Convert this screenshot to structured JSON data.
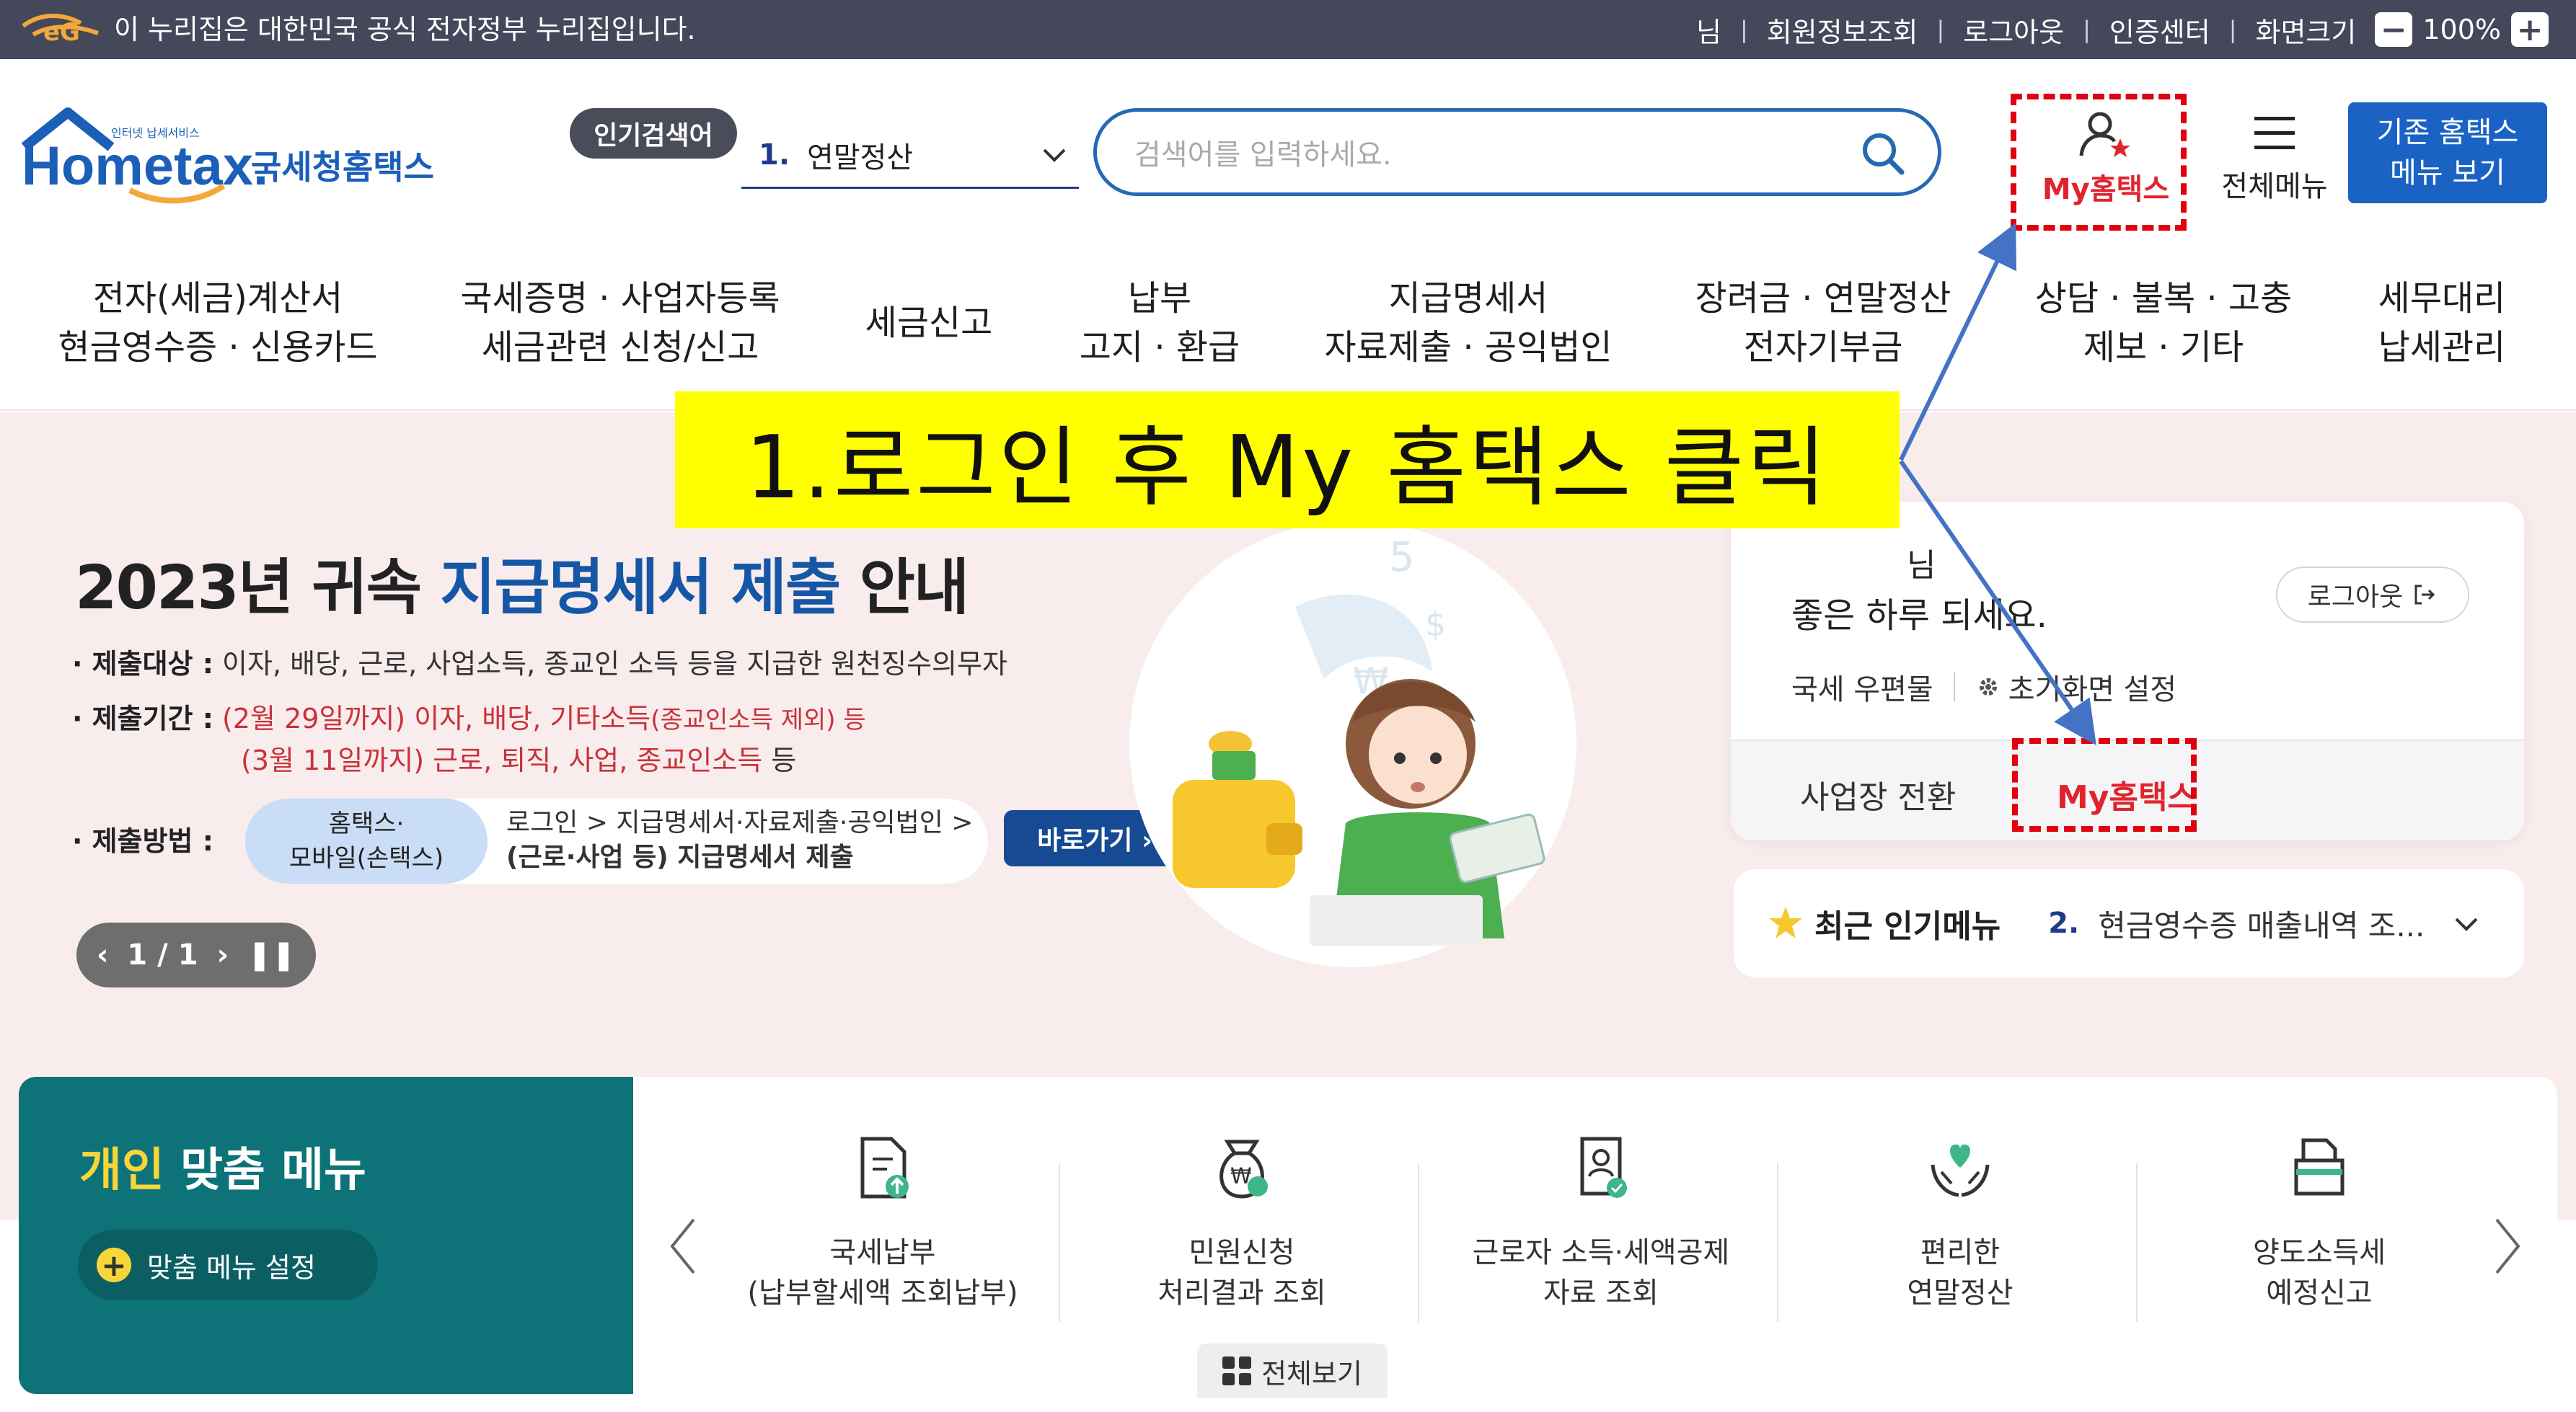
{
  "gov_bar": {
    "notice": "이 누리집은 대한민국 공식 전자정부 누리집입니다.",
    "user_suffix": "님",
    "links": [
      "회원정보조회",
      "로그아웃",
      "인증센터",
      "화면크기"
    ],
    "zoom": "100%",
    "zoom_out": "−",
    "zoom_in": "+"
  },
  "header": {
    "logo_small": "인터넷 납세서비스",
    "logo_main": "Hometax.",
    "logo_kr": "국세청홈택스",
    "hot_keyword_badge": "인기검색어",
    "hot_keyword_num": "1.",
    "hot_keyword_text": "연말정산",
    "search_placeholder": "검색어를 입력하세요.",
    "mytax_label": "My홈택스",
    "allmenu_label": "전체메뉴",
    "legacy_line1": "기존 홈택스",
    "legacy_line2": "메뉴 보기"
  },
  "gnb": [
    {
      "l1": "전자(세금)계산서",
      "l2": "현금영수증 · 신용카드"
    },
    {
      "l1": "국세증명 · 사업자등록",
      "l2": "세금관련 신청/신고"
    },
    {
      "l1": "세금신고",
      "l2": ""
    },
    {
      "l1": "납부",
      "l2": "고지 · 환급"
    },
    {
      "l1": "지급명세서",
      "l2": "자료제출 · 공익법인"
    },
    {
      "l1": "장려금 · 연말정산",
      "l2": "전자기부금"
    },
    {
      "l1": "상담 · 불복 · 고충",
      "l2": "제보 · 기타"
    },
    {
      "l1": "세무대리",
      "l2": "납세관리"
    }
  ],
  "hero": {
    "title_a": "2023년 귀속 ",
    "title_hl": "지급명세서 제출",
    "title_b": " 안내",
    "target_label": "· 제출대상 :",
    "target_text": "이자, 배당, 근로, 사업소득, 종교인 소득 등을 지급한 원천징수의무자",
    "period_label": "· 제출기간 :",
    "period1_red": "(2월 29일까지) 이자, 배당, 기타소득",
    "period1_rest": "(종교인소득 제외) 등",
    "period2_red": "(3월 11일까지) 근로, 퇴직, 사업, 종교인소득",
    "period2_rest": " 등",
    "method_label": "· 제출방법 :",
    "method_pill1": "홈택스·",
    "method_pill2": "모바일(손택스)",
    "method_desc1": "로그인 > 지급명세서·자료제출·공익법인 >",
    "method_desc2": "(근로·사업 등) 지급명세서 제출",
    "goto": "바로가기 ›",
    "pager": "1 / 1"
  },
  "login_panel": {
    "name_suffix": "님",
    "greeting": "좋은 하루 되세요.",
    "logout": "로그아웃",
    "mailbox": "국세 우편물",
    "init_screen": "초기화면 설정",
    "switch_biz": "사업장 전환",
    "mytax": "My홈택스"
  },
  "recent": {
    "title": "최근 인기메뉴",
    "num": "2.",
    "value": "현금영수증 매출내역 조..."
  },
  "callout": {
    "text": "1.로그인 후 My 홈택스 클릭"
  },
  "personal_menu": {
    "title_y": "개인",
    "title_w": " 맞춤 메뉴",
    "setting": "맞춤 메뉴 설정",
    "items": [
      {
        "l1": "국세납부",
        "l2": "(납부할세액 조회납부)"
      },
      {
        "l1": "민원신청",
        "l2": "처리결과 조회"
      },
      {
        "l1": "근로자 소득·세액공제",
        "l2": "자료 조회"
      },
      {
        "l1": "편리한",
        "l2": "연말정산"
      },
      {
        "l1": "양도소득세",
        "l2": "예정신고"
      }
    ],
    "view_all": "전체보기"
  },
  "colors": {
    "gov_bar": "#45485a",
    "brand_blue": "#1a63c4",
    "accent_red": "#e0242d",
    "hero_bg": "#f8ecec",
    "teal": "#0d7378",
    "callout": "#ffff00"
  }
}
